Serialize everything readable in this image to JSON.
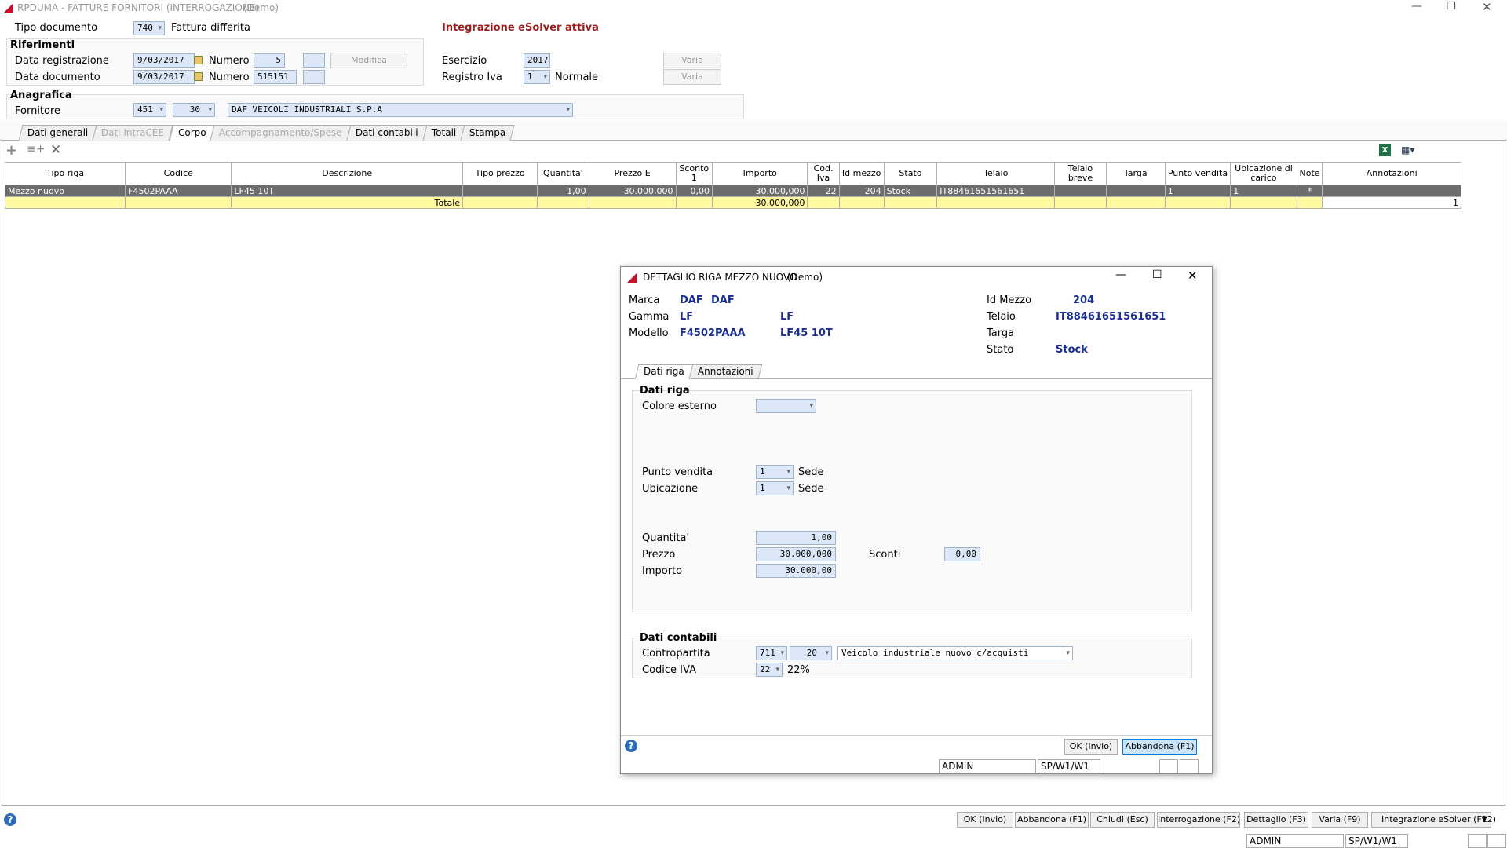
{
  "window": {
    "title": "RPDUMA - FATTURE FORNITORI (INTERROGAZIONE)",
    "demo": "(Demo)"
  },
  "header": {
    "tipo_documento_label": "Tipo documento",
    "tipo_documento_code": "740",
    "tipo_documento_desc": "Fattura differita",
    "integration_notice": "Integrazione eSolver attiva",
    "riferimenti_label": "Riferimenti",
    "data_registrazione_label": "Data registrazione",
    "data_registrazione": "9/03/2017",
    "numero_label": "Numero",
    "numero_reg": "5",
    "modifica_label": "Modifica",
    "data_documento_label": "Data documento",
    "data_documento": "9/03/2017",
    "numero_doc": "515151",
    "esercizio_label": "Esercizio",
    "esercizio": "2017",
    "registro_iva_label": "Registro Iva",
    "registro_iva": "1",
    "registro_iva_desc": "Normale",
    "varia_label": "Varia",
    "anagrafica_label": "Anagrafica",
    "fornitore_label": "Fornitore",
    "fornitore_code1": "451",
    "fornitore_code2": "30",
    "fornitore_name": "DAF VEICOLI INDUSTRIALI S.P.A"
  },
  "tabs": [
    {
      "label": "Dati generali",
      "state": "normal"
    },
    {
      "label": "Dati IntraCEE",
      "state": "disabled"
    },
    {
      "label": "Corpo",
      "state": "active"
    },
    {
      "label": "Accompagnamento/Spese",
      "state": "disabled"
    },
    {
      "label": "Dati contabili",
      "state": "normal"
    },
    {
      "label": "Totali",
      "state": "normal"
    },
    {
      "label": "Stampa",
      "state": "normal"
    }
  ],
  "grid": {
    "columns": [
      "Tipo riga",
      "Codice",
      "Descrizione",
      "Tipo prezzo",
      "Quantita'",
      "Prezzo E",
      "Sconto 1",
      "Importo",
      "Cod. Iva",
      "Id mezzo",
      "Stato",
      "Telaio",
      "Telaio breve",
      "Targa",
      "Punto vendita",
      "Ubicazione di carico",
      "Note",
      "Annotazioni"
    ],
    "row": [
      "Mezzo nuovo",
      "F4502PAAA",
      "LF45 10T",
      "",
      "1,00",
      "30.000,000",
      "0,00",
      "30.000,000",
      "22",
      "204",
      "Stock",
      "IT88461651561651",
      "",
      "",
      "1",
      "1",
      "*",
      ""
    ],
    "total_label": "Totale",
    "total_value": "30.000,000",
    "total_annot": "1"
  },
  "dialog": {
    "title": "DETTAGLIO RIGA MEZZO NUOVO",
    "demo": "(Demo)",
    "marca_label": "Marca",
    "marca_code": "DAF",
    "marca_desc": "DAF",
    "gamma_label": "Gamma",
    "gamma_code": "LF",
    "gamma_desc": "LF",
    "modello_label": "Modello",
    "modello_code": "F4502PAAA",
    "modello_desc": "LF45 10T",
    "id_mezzo_label": "Id Mezzo",
    "id_mezzo": "204",
    "telaio_label": "Telaio",
    "telaio": "IT88461651561651",
    "targa_label": "Targa",
    "stato_label": "Stato",
    "stato": "Stock",
    "tab1": "Dati riga",
    "tab2": "Annotazioni",
    "dati_riga_label": "Dati riga",
    "colore_label": "Colore esterno",
    "punto_vendita_label": "Punto vendita",
    "punto_vendita": "1",
    "punto_vendita_desc": "Sede",
    "ubicazione_label": "Ubicazione",
    "ubicazione": "1",
    "ubicazione_desc": "Sede",
    "quantita_label": "Quantita'",
    "quantita": "1,00",
    "prezzo_label": "Prezzo",
    "prezzo": "30.000,000",
    "sconti_label": "Sconti",
    "sconti": "0,00",
    "importo_label": "Importo",
    "importo": "30.000,00",
    "dati_contabili_label": "Dati contabili",
    "contropartita_label": "Contropartita",
    "contropartita1": "711",
    "contropartita2": "20",
    "contropartita_desc": "Veicolo industriale nuovo c/acquisti",
    "codice_iva_label": "Codice IVA",
    "codice_iva": "22",
    "codice_iva_desc": "22%",
    "ok_label": "OK (Invio)",
    "abbandona_label": "Abbandona (F1)",
    "status_user": "ADMIN",
    "status_path": "SP/W1/W1"
  },
  "bottom": {
    "buttons": [
      "OK (Invio)",
      "Abbandona (F1)",
      "Chiudi (Esc)",
      "Interrogazione (F2)",
      "Dettaglio (F3)",
      "Varia (F9)",
      "Integrazione eSolver (F12)"
    ],
    "status_user": "ADMIN",
    "status_path": "SP/W1/W1"
  },
  "icons": {
    "app": "app-logo-icon",
    "add": "add-row-icon",
    "insert": "insert-row-icon",
    "delete": "delete-row-icon",
    "excel": "excel-icon",
    "columns": "columns-icon",
    "help": "help-icon"
  }
}
